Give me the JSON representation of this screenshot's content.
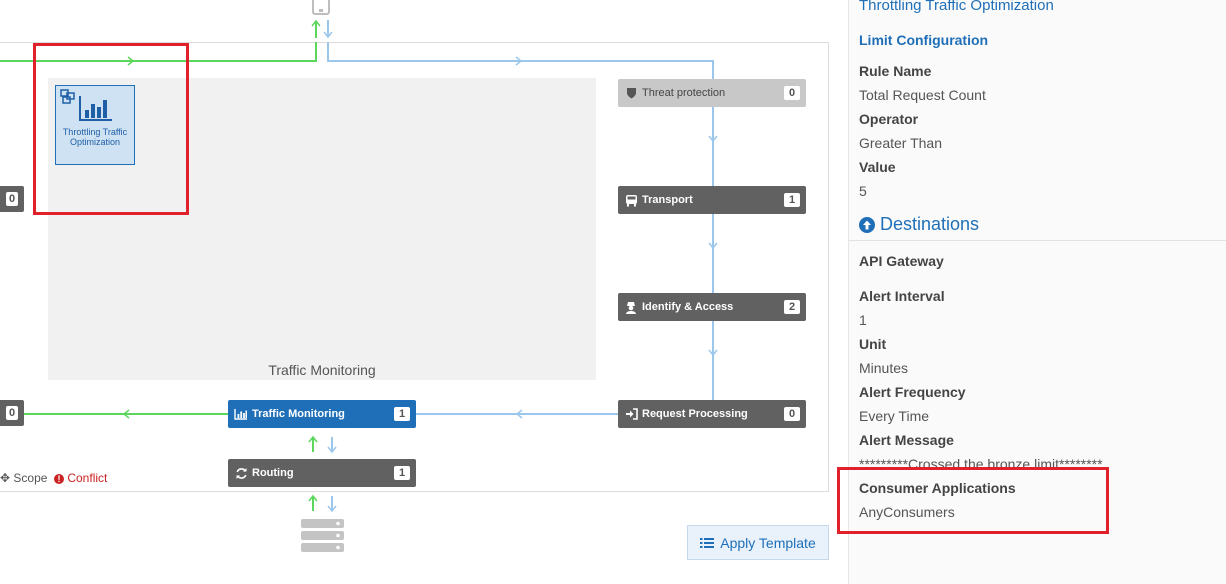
{
  "canvas": {
    "zone_label": "Traffic Monitoring",
    "policy_label": "Throttling Traffic Optimization",
    "nodes": {
      "threat": {
        "label": "Threat protection",
        "count": "0"
      },
      "transport": {
        "label": "Transport",
        "count": "1"
      },
      "identify": {
        "label": "Identify & Access",
        "count": "2"
      },
      "request": {
        "label": "Request Processing",
        "count": "0"
      },
      "traffic": {
        "label": "Traffic Monitoring",
        "count": "1"
      },
      "routing": {
        "label": "Routing",
        "count": "1"
      },
      "left_top_stub": {
        "count": "0"
      },
      "left_bottom_stub": {
        "count": "0"
      }
    },
    "legend": {
      "scope": "Scope",
      "conflict": "Conflict"
    },
    "apply_template": "Apply Template"
  },
  "panel": {
    "title": "Throttling Traffic Optimization",
    "limit_heading": "Limit Configuration",
    "rule_name_label": "Rule Name",
    "rule_name_value": "Total Request Count",
    "operator_label": "Operator",
    "operator_value": "Greater Than",
    "value_label": "Value",
    "value_value": "5",
    "destinations_heading": "Destinations",
    "api_gateway": "API Gateway",
    "alert_interval_label": "Alert Interval",
    "alert_interval_value": "1",
    "unit_label": "Unit",
    "unit_value": "Minutes",
    "alert_frequency_label": "Alert Frequency",
    "alert_frequency_value": "Every Time",
    "alert_message_label": "Alert Message",
    "alert_message_value": "*********Crossed the bronze limit********",
    "consumer_apps_label": "Consumer Applications",
    "consumer_apps_value": "AnyConsumers"
  },
  "colors": {
    "accent": "#1f6fb8",
    "node": "#616161",
    "highlight": "#e0202a",
    "flow_green": "#5cd65c",
    "flow_blue": "#9cc7ec"
  }
}
